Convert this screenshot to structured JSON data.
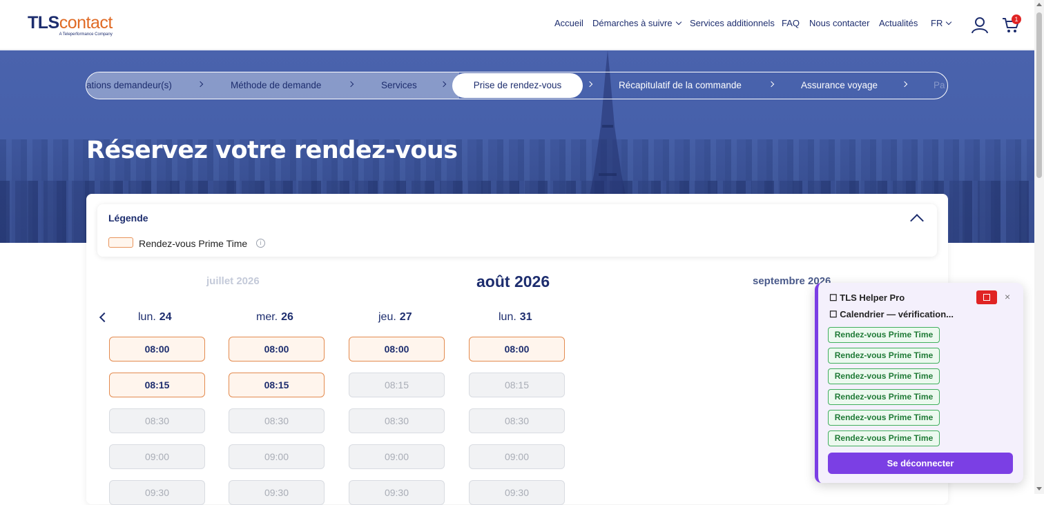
{
  "header": {
    "logo_main": "TLS",
    "logo_accent": "contact",
    "logo_tagline": "A Teleperformance Company",
    "nav": [
      {
        "label": "Accueil"
      },
      {
        "label": "Démarches à suivre"
      },
      {
        "label": "Services additionnels"
      },
      {
        "label": "FAQ"
      },
      {
        "label": "Nous contacter"
      },
      {
        "label": "Actualités"
      },
      {
        "label": "FR"
      }
    ],
    "cart_count": "1"
  },
  "stepper": {
    "steps": [
      {
        "label": "ations demandeur(s)",
        "state": "done"
      },
      {
        "label": "Méthode de demande",
        "state": "done"
      },
      {
        "label": "Services",
        "state": "done"
      },
      {
        "label": "Prise de rendez-vous",
        "state": "active"
      },
      {
        "label": "Récapitulatif de la commande",
        "state": "todo"
      },
      {
        "label": "Assurance voyage",
        "state": "todo"
      },
      {
        "label": "Pa",
        "state": "todo"
      }
    ]
  },
  "page": {
    "title": "Réservez votre rendez-vous"
  },
  "legend": {
    "title": "Légende",
    "item_label": "Rendez-vous Prime Time",
    "info_glyph": "i"
  },
  "calendar": {
    "prev_month": "juillet 2026",
    "current_month": "août 2026",
    "next_month": "septembre 2026",
    "days": [
      {
        "weekday": "lun.",
        "day": "24",
        "slots": [
          {
            "time": "08:00",
            "available": true
          },
          {
            "time": "08:15",
            "available": true
          },
          {
            "time": "08:30",
            "available": false
          },
          {
            "time": "09:00",
            "available": false
          },
          {
            "time": "09:30",
            "available": false
          }
        ]
      },
      {
        "weekday": "mer.",
        "day": "26",
        "slots": [
          {
            "time": "08:00",
            "available": true
          },
          {
            "time": "08:15",
            "available": true
          },
          {
            "time": "08:30",
            "available": false
          },
          {
            "time": "09:00",
            "available": false
          },
          {
            "time": "09:30",
            "available": false
          }
        ]
      },
      {
        "weekday": "jeu.",
        "day": "27",
        "slots": [
          {
            "time": "08:00",
            "available": true
          },
          {
            "time": "08:15",
            "available": false
          },
          {
            "time": "08:30",
            "available": false
          },
          {
            "time": "09:00",
            "available": false
          },
          {
            "time": "09:30",
            "available": false
          }
        ]
      },
      {
        "weekday": "lun.",
        "day": "31",
        "slots": [
          {
            "time": "08:00",
            "available": true
          },
          {
            "time": "08:15",
            "available": false
          },
          {
            "time": "08:30",
            "available": false
          },
          {
            "time": "09:00",
            "available": false
          },
          {
            "time": "09:30",
            "available": false
          }
        ]
      }
    ]
  },
  "helper": {
    "title": "☐ TLS Helper Pro",
    "subtitle": "☐ Calendrier — vérification...",
    "close": "×",
    "chips": [
      "Rendez-vous Prime Time",
      "Rendez-vous Prime Time",
      "Rendez-vous Prime Time",
      "Rendez-vous Prime Time",
      "Rendez-vous Prime Time",
      "Rendez-vous Prime Time"
    ],
    "button": "Se déconnecter"
  },
  "colors": {
    "brand_navy": "#1d2d6e",
    "brand_orange": "#e06a24",
    "helper_purple": "#7b3fe4",
    "chip_green": "#3fae5c"
  }
}
